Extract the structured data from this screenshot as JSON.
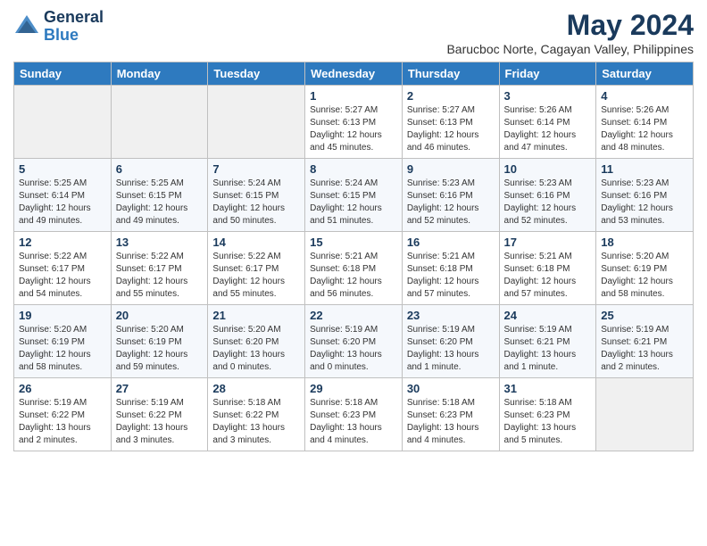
{
  "logo": {
    "general": "General",
    "blue": "Blue"
  },
  "title": {
    "month_year": "May 2024",
    "location": "Barucboc Norte, Cagayan Valley, Philippines"
  },
  "headers": [
    "Sunday",
    "Monday",
    "Tuesday",
    "Wednesday",
    "Thursday",
    "Friday",
    "Saturday"
  ],
  "weeks": [
    [
      {
        "day": "",
        "detail": ""
      },
      {
        "day": "",
        "detail": ""
      },
      {
        "day": "",
        "detail": ""
      },
      {
        "day": "1",
        "detail": "Sunrise: 5:27 AM\nSunset: 6:13 PM\nDaylight: 12 hours\nand 45 minutes."
      },
      {
        "day": "2",
        "detail": "Sunrise: 5:27 AM\nSunset: 6:13 PM\nDaylight: 12 hours\nand 46 minutes."
      },
      {
        "day": "3",
        "detail": "Sunrise: 5:26 AM\nSunset: 6:14 PM\nDaylight: 12 hours\nand 47 minutes."
      },
      {
        "day": "4",
        "detail": "Sunrise: 5:26 AM\nSunset: 6:14 PM\nDaylight: 12 hours\nand 48 minutes."
      }
    ],
    [
      {
        "day": "5",
        "detail": "Sunrise: 5:25 AM\nSunset: 6:14 PM\nDaylight: 12 hours\nand 49 minutes."
      },
      {
        "day": "6",
        "detail": "Sunrise: 5:25 AM\nSunset: 6:15 PM\nDaylight: 12 hours\nand 49 minutes."
      },
      {
        "day": "7",
        "detail": "Sunrise: 5:24 AM\nSunset: 6:15 PM\nDaylight: 12 hours\nand 50 minutes."
      },
      {
        "day": "8",
        "detail": "Sunrise: 5:24 AM\nSunset: 6:15 PM\nDaylight: 12 hours\nand 51 minutes."
      },
      {
        "day": "9",
        "detail": "Sunrise: 5:23 AM\nSunset: 6:16 PM\nDaylight: 12 hours\nand 52 minutes."
      },
      {
        "day": "10",
        "detail": "Sunrise: 5:23 AM\nSunset: 6:16 PM\nDaylight: 12 hours\nand 52 minutes."
      },
      {
        "day": "11",
        "detail": "Sunrise: 5:23 AM\nSunset: 6:16 PM\nDaylight: 12 hours\nand 53 minutes."
      }
    ],
    [
      {
        "day": "12",
        "detail": "Sunrise: 5:22 AM\nSunset: 6:17 PM\nDaylight: 12 hours\nand 54 minutes."
      },
      {
        "day": "13",
        "detail": "Sunrise: 5:22 AM\nSunset: 6:17 PM\nDaylight: 12 hours\nand 55 minutes."
      },
      {
        "day": "14",
        "detail": "Sunrise: 5:22 AM\nSunset: 6:17 PM\nDaylight: 12 hours\nand 55 minutes."
      },
      {
        "day": "15",
        "detail": "Sunrise: 5:21 AM\nSunset: 6:18 PM\nDaylight: 12 hours\nand 56 minutes."
      },
      {
        "day": "16",
        "detail": "Sunrise: 5:21 AM\nSunset: 6:18 PM\nDaylight: 12 hours\nand 57 minutes."
      },
      {
        "day": "17",
        "detail": "Sunrise: 5:21 AM\nSunset: 6:18 PM\nDaylight: 12 hours\nand 57 minutes."
      },
      {
        "day": "18",
        "detail": "Sunrise: 5:20 AM\nSunset: 6:19 PM\nDaylight: 12 hours\nand 58 minutes."
      }
    ],
    [
      {
        "day": "19",
        "detail": "Sunrise: 5:20 AM\nSunset: 6:19 PM\nDaylight: 12 hours\nand 58 minutes."
      },
      {
        "day": "20",
        "detail": "Sunrise: 5:20 AM\nSunset: 6:19 PM\nDaylight: 12 hours\nand 59 minutes."
      },
      {
        "day": "21",
        "detail": "Sunrise: 5:20 AM\nSunset: 6:20 PM\nDaylight: 13 hours\nand 0 minutes."
      },
      {
        "day": "22",
        "detail": "Sunrise: 5:19 AM\nSunset: 6:20 PM\nDaylight: 13 hours\nand 0 minutes."
      },
      {
        "day": "23",
        "detail": "Sunrise: 5:19 AM\nSunset: 6:20 PM\nDaylight: 13 hours\nand 1 minute."
      },
      {
        "day": "24",
        "detail": "Sunrise: 5:19 AM\nSunset: 6:21 PM\nDaylight: 13 hours\nand 1 minute."
      },
      {
        "day": "25",
        "detail": "Sunrise: 5:19 AM\nSunset: 6:21 PM\nDaylight: 13 hours\nand 2 minutes."
      }
    ],
    [
      {
        "day": "26",
        "detail": "Sunrise: 5:19 AM\nSunset: 6:22 PM\nDaylight: 13 hours\nand 2 minutes."
      },
      {
        "day": "27",
        "detail": "Sunrise: 5:19 AM\nSunset: 6:22 PM\nDaylight: 13 hours\nand 3 minutes."
      },
      {
        "day": "28",
        "detail": "Sunrise: 5:18 AM\nSunset: 6:22 PM\nDaylight: 13 hours\nand 3 minutes."
      },
      {
        "day": "29",
        "detail": "Sunrise: 5:18 AM\nSunset: 6:23 PM\nDaylight: 13 hours\nand 4 minutes."
      },
      {
        "day": "30",
        "detail": "Sunrise: 5:18 AM\nSunset: 6:23 PM\nDaylight: 13 hours\nand 4 minutes."
      },
      {
        "day": "31",
        "detail": "Sunrise: 5:18 AM\nSunset: 6:23 PM\nDaylight: 13 hours\nand 5 minutes."
      },
      {
        "day": "",
        "detail": ""
      }
    ]
  ]
}
